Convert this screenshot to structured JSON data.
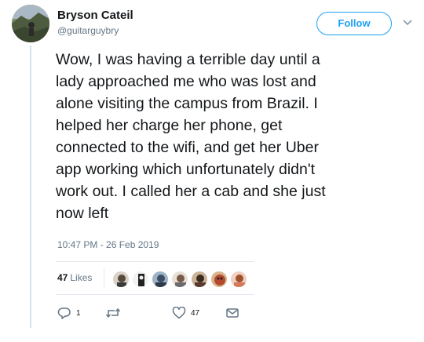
{
  "user": {
    "display_name": "Bryson Cateil",
    "handle": "@guitarguybry",
    "avatar": "user-avatar"
  },
  "header": {
    "follow_label": "Follow",
    "menu_icon": "chevron-down-icon"
  },
  "tweet": {
    "text": "Wow, I was having a terrible day until a\nlady approached me who was lost and\nalone visiting the campus from Brazil. I\nhelped her charge her phone, get\nconnected to the wifi, and get her Uber\napp working which unfortunately didn't\nwork out. I called her a cab and she just\nnow left",
    "timestamp": "10:47 PM - 26 Feb 2019"
  },
  "stats": {
    "likes_count": "47",
    "likes_label": "Likes",
    "liker_count": 7
  },
  "actions": {
    "reply_icon": "reply-icon",
    "reply_count": "1",
    "retweet_icon": "retweet-icon",
    "like_icon": "heart-icon",
    "like_count": "47",
    "message_icon": "envelope-icon"
  },
  "colors": {
    "accent": "#1da1f2",
    "secondary_text": "#657786",
    "thread_line": "#cfe3f1"
  }
}
